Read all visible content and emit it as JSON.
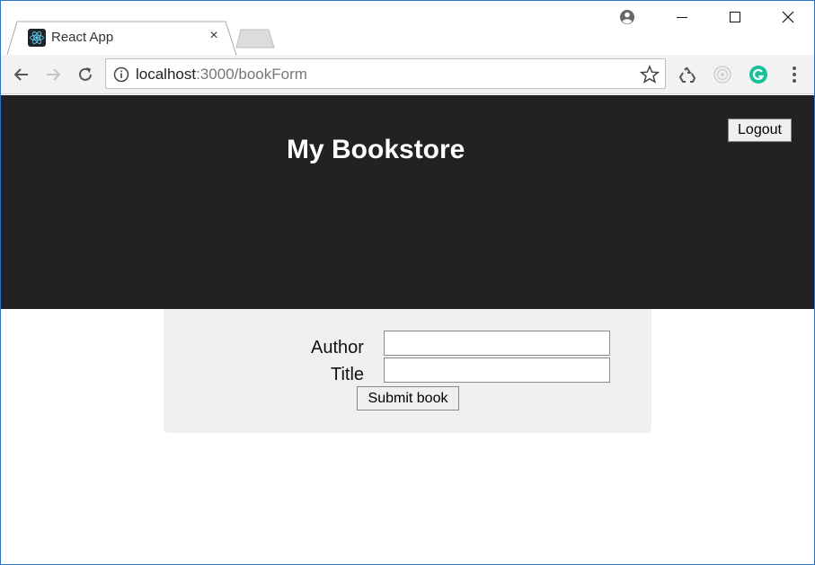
{
  "browser": {
    "tab": {
      "title": "React App",
      "close_glyph": "×",
      "favicon": "react-icon"
    },
    "url": {
      "host": "localhost",
      "path": ":3000/bookForm"
    },
    "extensions": [
      "recycle-icon",
      "target-icon",
      "grammarly-icon"
    ],
    "colors": {
      "frame_border": "#2b73c4",
      "grammarly": "#15c39a",
      "react": "#61dafb"
    }
  },
  "header": {
    "title": "My Bookstore",
    "logout_label": "Logout",
    "background": "#222222"
  },
  "form": {
    "author_label": "Author",
    "author_value": "",
    "title_label": "Title",
    "title_value": "",
    "submit_label": "Submit book",
    "background": "#f0f0f0"
  }
}
